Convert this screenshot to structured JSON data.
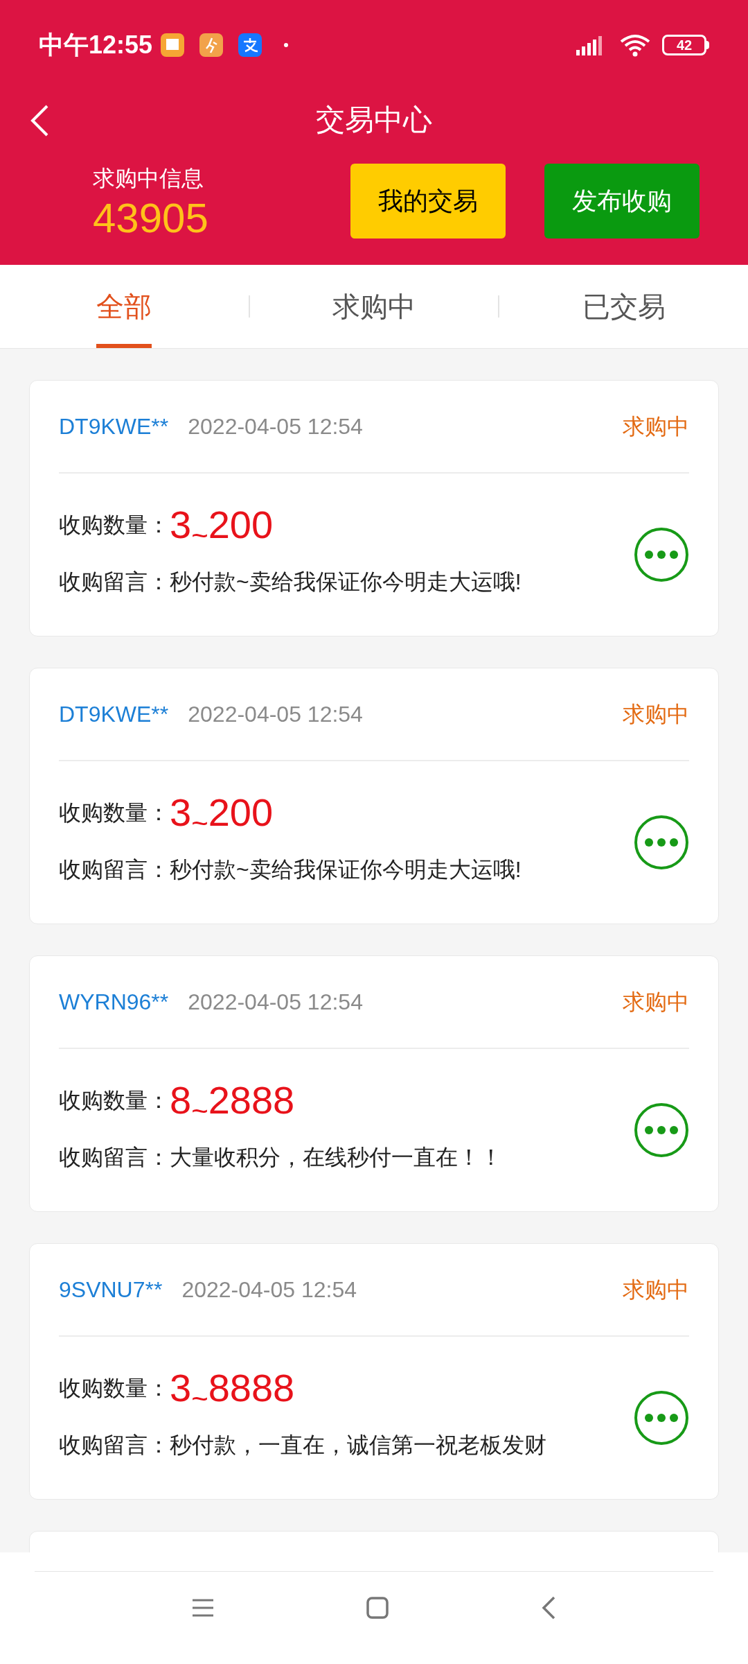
{
  "status_bar": {
    "time": "中午12:55",
    "battery": "42"
  },
  "header": {
    "title": "交易中心"
  },
  "summary": {
    "label": "求购中信息",
    "value": "43905"
  },
  "actions": [
    {
      "label": "我的交易",
      "kind": "yellow"
    },
    {
      "label": "发布收购",
      "kind": "green"
    }
  ],
  "tabs": [
    {
      "label": "全部",
      "selected": true
    },
    {
      "label": "求购中",
      "selected": false
    },
    {
      "label": "已交易",
      "selected": false
    }
  ],
  "listings": [
    {
      "user": "DT9KWE**",
      "time": "2022-04-05 12:54",
      "status": "求购中",
      "quantity_label": "收购数量：",
      "quantity": "3$_{~}$200",
      "message_label": "收购留言：",
      "message": "秒付款~卖给我保证你今明走大运哦!"
    },
    {
      "user": "DT9KWE**",
      "time": "2022-04-05 12:54",
      "status": "求购中",
      "quantity_label": "收购数量：",
      "quantity": "3$_{~}$200",
      "message_label": "收购留言：",
      "message": "秒付款~卖给我保证你今明走大运哦!"
    },
    {
      "user": "WYRN96**",
      "time": "2022-04-05 12:54",
      "status": "求购中",
      "quantity_label": "收购数量：",
      "quantity": "8$_{~}$2888",
      "message_label": "收购留言：",
      "message": "大量收积分，在线秒付一直在！！"
    },
    {
      "user": "9SVNU7**",
      "time": "2022-04-05 12:54",
      "status": "求购中",
      "quantity_label": "收购数量：",
      "quantity": "3$_{~}$8888",
      "message_label": "收购留言：",
      "message": "秒付款，一直在，诚信第一祝老板发财"
    }
  ]
}
